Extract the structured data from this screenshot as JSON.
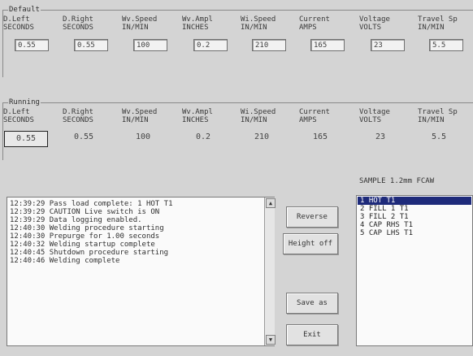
{
  "default_group": {
    "title": "Default",
    "columns": [
      {
        "h1": "D.Left",
        "h2": "SECONDS",
        "value": "0.55"
      },
      {
        "h1": "D.Right",
        "h2": "SECONDS",
        "value": "0.55"
      },
      {
        "h1": "Wv.Speed",
        "h2": "IN/MIN",
        "value": "100"
      },
      {
        "h1": "Wv.Ampl",
        "h2": "INCHES",
        "value": "0.2"
      },
      {
        "h1": "Wi.Speed",
        "h2": "IN/MIN",
        "value": "210"
      },
      {
        "h1": "Current",
        "h2": "AMPS",
        "value": "165"
      },
      {
        "h1": "Voltage",
        "h2": "VOLTS",
        "value": "23"
      },
      {
        "h1": "Travel Sp",
        "h2": "IN/MIN",
        "value": "5.5"
      }
    ]
  },
  "running_group": {
    "title": "Running",
    "columns": [
      {
        "h1": "D.Left",
        "h2": "SECONDS",
        "value": "0.55"
      },
      {
        "h1": "D.Right",
        "h2": "SECONDS",
        "value": "0.55"
      },
      {
        "h1": "Wv.Speed",
        "h2": "IN/MIN",
        "value": "100"
      },
      {
        "h1": "Wv.Ampl",
        "h2": "INCHES",
        "value": "0.2"
      },
      {
        "h1": "Wi.Speed",
        "h2": "IN/MIN",
        "value": "210"
      },
      {
        "h1": "Current",
        "h2": "AMPS",
        "value": "165"
      },
      {
        "h1": "Voltage",
        "h2": "VOLTS",
        "value": "23"
      },
      {
        "h1": "Travel Sp",
        "h2": "IN/MIN",
        "value": "5.5"
      }
    ]
  },
  "log": [
    "12:39:29 Pass load complete: 1 HOT T1",
    "12:39:29 CAUTION Live switch is ON",
    "12:39:29 Data logging enabled.",
    "12:40:30 Welding procedure starting",
    "12:40:30 Prepurge for 1.00 seconds",
    "12:40:32 Welding startup complete",
    "12:40:45 Shutdown procedure starting",
    "12:40:46 Welding complete"
  ],
  "buttons": {
    "reverse": "Reverse",
    "height_off": "Height off",
    "save_as": "Save as",
    "exit": "Exit"
  },
  "procedure": {
    "title": "SAMPLE 1.2mm FCAW",
    "items": [
      "1 HOT T1",
      "2 FILL 1 T1",
      "3 FILL 2 T1",
      "4 CAP RHS T1",
      "5 CAP LHS T1"
    ],
    "selected_index": 0
  },
  "icons": {
    "scroll_up": "▲",
    "scroll_down": "▼"
  },
  "colors": {
    "selection": "#1e2a7a",
    "background": "#d4d4d4"
  }
}
